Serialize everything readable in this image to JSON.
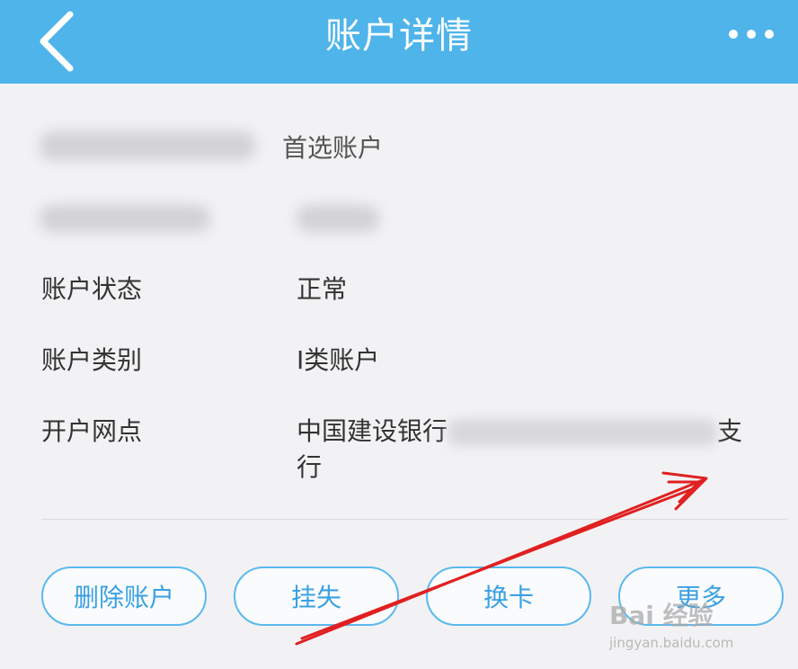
{
  "header": {
    "title": "账户详情",
    "back_icon": "chevron-left-icon",
    "more_icon": "more-dots-icon",
    "bg_color": "#4fb4ea"
  },
  "account": {
    "preferred_tag": "首选账户",
    "rows": [
      {
        "label": "账户状态",
        "value": "正常"
      },
      {
        "label": "账户类别",
        "value": "I类账户"
      },
      {
        "label": "开户网点",
        "value_prefix": "中国建设银行",
        "value_suffix": "支",
        "value_line2": "行"
      }
    ]
  },
  "buttons": [
    {
      "label": "删除账户"
    },
    {
      "label": "挂失"
    },
    {
      "label": "换卡"
    },
    {
      "label": "更多"
    }
  ],
  "watermark": {
    "brand": "Bai 经验",
    "url": "jingyan.baidu.com"
  },
  "colors": {
    "accent": "#3aa1e2",
    "annotation_arrow": "#e02020"
  }
}
